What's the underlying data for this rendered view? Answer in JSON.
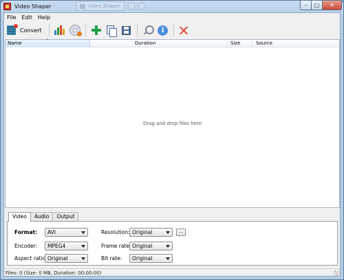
{
  "window": {
    "title": "Video Shaper",
    "ghost_tab": "Video Shaper"
  },
  "menu": [
    "File",
    "Edit",
    "Help"
  ],
  "toolbar": {
    "convert_label": "Convert"
  },
  "file_list": {
    "columns": [
      "Name",
      "Duration",
      "Size",
      "Source"
    ],
    "empty_hint": "Drag and drop files here",
    "rows": []
  },
  "tabs": [
    "Video",
    "Audio",
    "Output"
  ],
  "video_settings": {
    "format_label": "Format:",
    "format_value": "AVI",
    "encoder_label": "Encoder:",
    "encoder_value": "MPEG4",
    "aspect_label": "Aspect ratio:",
    "aspect_value": "Original",
    "resolution_label": "Resolution:",
    "resolution_value": "Original",
    "more_label": "...",
    "framerate_label": "Frame rate:",
    "framerate_value": "Original",
    "bitrate_label": "Bit rate:",
    "bitrate_value": "Original"
  },
  "status": "Files: 0 (Size: 0 MB, Duration: 00:00:00)"
}
